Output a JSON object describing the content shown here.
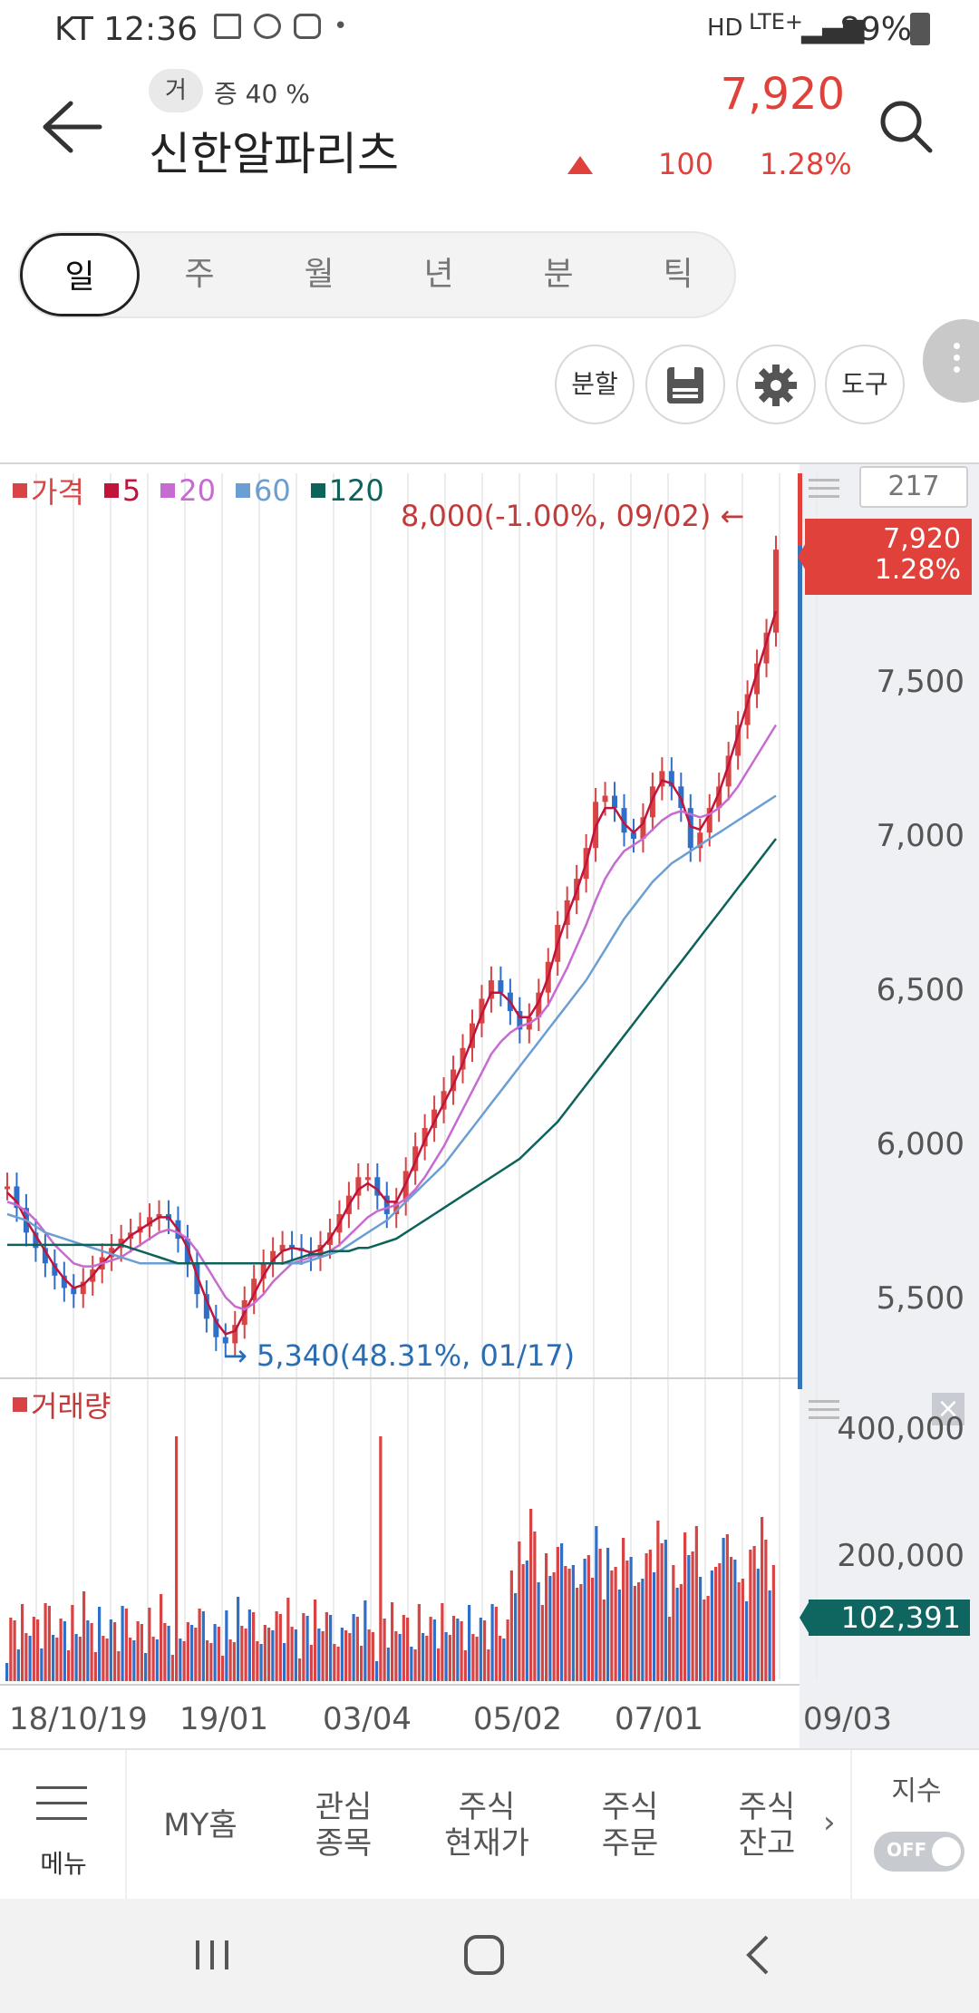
{
  "status_bar": {
    "carrier_time": "KT 12:36",
    "dot": "•",
    "network": "LTE+",
    "battery": "89%"
  },
  "header": {
    "volume_badge": "거",
    "volume_text": "증 40 %",
    "stock_name": "신한알파리츠",
    "price": "7,920",
    "change": "100",
    "change_pct": "1.28%"
  },
  "period_tabs": [
    "일",
    "주",
    "월",
    "년",
    "분",
    "틱"
  ],
  "period_active": "일",
  "tools": [
    "분할",
    "",
    "",
    "도구"
  ],
  "chart": {
    "legend": [
      {
        "label": "가격",
        "color": "#d84343"
      },
      {
        "label": "5",
        "color": "#c0143c"
      },
      {
        "label": "20",
        "color": "#c76ad1"
      },
      {
        "label": "60",
        "color": "#6b9ed3"
      },
      {
        "label": "120",
        "color": "#0d6259"
      }
    ],
    "max_label": "8,000(-1.00%, 09/02) ←",
    "min_label": "→ 5,340(48.31%, 01/17)",
    "count": "217",
    "current_price": "7,920",
    "current_pct": "1.28%",
    "volume_legend": "거래량",
    "current_volume": "102,391"
  },
  "chart_data": {
    "type": "line",
    "price_axis": {
      "ticks": [
        "7,500",
        "7,000",
        "6,500",
        "6,000",
        "5,500"
      ],
      "ylim": [
        5250,
        8050
      ]
    },
    "volume_axis": {
      "ticks": [
        "400,000",
        "200,000"
      ]
    },
    "x_labels": [
      "18/10/19",
      "19/01",
      "03/04",
      "05/02",
      "07/01",
      "09/03"
    ],
    "series": [
      {
        "name": "가격",
        "values": [
          5850,
          5780,
          5700,
          5650,
          5600,
          5560,
          5520,
          5500,
          5540,
          5580,
          5620,
          5650,
          5680,
          5700,
          5720,
          5750,
          5760,
          5740,
          5680,
          5600,
          5500,
          5420,
          5360,
          5340,
          5400,
          5480,
          5550,
          5600,
          5640,
          5660,
          5650,
          5640,
          5620,
          5660,
          5700,
          5760,
          5820,
          5880,
          5880,
          5820,
          5760,
          5800,
          5900,
          5980,
          6040,
          6100,
          6160,
          6230,
          6300,
          6380,
          6460,
          6520,
          6480,
          6420,
          6360,
          6400,
          6480,
          6580,
          6700,
          6780,
          6850,
          6950,
          7100,
          7120,
          7080,
          7000,
          6980,
          7050,
          7150,
          7200,
          7150,
          7080,
          6950,
          7000,
          7080,
          7150,
          7250,
          7350,
          7450,
          7550,
          7650,
          7920
        ]
      },
      {
        "name": "5",
        "values": [
          5830,
          5800,
          5740,
          5690,
          5640,
          5590,
          5550,
          5520,
          5530,
          5560,
          5600,
          5630,
          5660,
          5690,
          5710,
          5730,
          5750,
          5750,
          5710,
          5650,
          5560,
          5480,
          5410,
          5370,
          5380,
          5440,
          5500,
          5560,
          5610,
          5640,
          5650,
          5645,
          5635,
          5645,
          5680,
          5730,
          5790,
          5840,
          5860,
          5840,
          5800,
          5800,
          5860,
          5930,
          6000,
          6060,
          6120,
          6180,
          6250,
          6330,
          6410,
          6480,
          6480,
          6450,
          6400,
          6400,
          6450,
          6530,
          6640,
          6730,
          6810,
          6900,
          7020,
          7080,
          7080,
          7030,
          7000,
          7030,
          7110,
          7170,
          7160,
          7110,
          7020,
          7010,
          7060,
          7130,
          7220,
          7320,
          7420,
          7520,
          7620,
          7720
        ]
      },
      {
        "name": "20",
        "values": [
          5800,
          5790,
          5770,
          5740,
          5700,
          5660,
          5630,
          5600,
          5590,
          5590,
          5600,
          5610,
          5620,
          5640,
          5660,
          5680,
          5700,
          5710,
          5700,
          5680,
          5640,
          5590,
          5540,
          5490,
          5460,
          5450,
          5470,
          5500,
          5540,
          5570,
          5600,
          5610,
          5620,
          5630,
          5640,
          5660,
          5690,
          5720,
          5750,
          5770,
          5780,
          5790,
          5810,
          5840,
          5880,
          5930,
          5980,
          6040,
          6100,
          6160,
          6220,
          6280,
          6320,
          6350,
          6370,
          6380,
          6400,
          6440,
          6500,
          6560,
          6630,
          6700,
          6780,
          6850,
          6900,
          6940,
          6960,
          6980,
          7010,
          7040,
          7060,
          7070,
          7060,
          7050,
          7060,
          7080,
          7110,
          7150,
          7200,
          7250,
          7300,
          7350
        ]
      },
      {
        "name": "60",
        "values": [
          5760,
          5750,
          5740,
          5720,
          5700,
          5690,
          5680,
          5670,
          5660,
          5650,
          5640,
          5630,
          5620,
          5610,
          5600,
          5600,
          5600,
          5600,
          5600,
          5600,
          5600,
          5600,
          5600,
          5600,
          5600,
          5600,
          5600,
          5600,
          5600,
          5600,
          5600,
          5600,
          5610,
          5620,
          5630,
          5640,
          5660,
          5680,
          5700,
          5720,
          5740,
          5770,
          5800,
          5830,
          5860,
          5890,
          5920,
          5960,
          6000,
          6040,
          6080,
          6120,
          6160,
          6200,
          6240,
          6280,
          6320,
          6360,
          6400,
          6440,
          6480,
          6520,
          6570,
          6620,
          6670,
          6720,
          6760,
          6800,
          6840,
          6870,
          6900,
          6920,
          6940,
          6960,
          6980,
          7000,
          7020,
          7040,
          7060,
          7080,
          7100,
          7120
        ]
      },
      {
        "name": "120",
        "values": [
          5660,
          5660,
          5660,
          5660,
          5660,
          5660,
          5660,
          5660,
          5660,
          5660,
          5660,
          5660,
          5660,
          5650,
          5640,
          5630,
          5620,
          5610,
          5600,
          5600,
          5600,
          5600,
          5600,
          5600,
          5600,
          5600,
          5600,
          5600,
          5600,
          5600,
          5610,
          5620,
          5630,
          5630,
          5640,
          5640,
          5640,
          5650,
          5650,
          5660,
          5670,
          5680,
          5700,
          5720,
          5740,
          5760,
          5780,
          5800,
          5820,
          5840,
          5860,
          5880,
          5900,
          5920,
          5940,
          5970,
          6000,
          6030,
          6060,
          6100,
          6140,
          6180,
          6220,
          6260,
          6300,
          6340,
          6380,
          6420,
          6460,
          6500,
          6540,
          6580,
          6620,
          6660,
          6700,
          6740,
          6780,
          6820,
          6860,
          6900,
          6940,
          6980
        ]
      }
    ]
  },
  "bottom_nav": {
    "menu_label": "메뉴",
    "items": [
      "MY홈",
      "관심\n종목",
      "주식\n현재가",
      "주식\n주문",
      "주식\n잔고"
    ],
    "chevron": "›",
    "index_label": "지수",
    "toggle": "OFF"
  }
}
